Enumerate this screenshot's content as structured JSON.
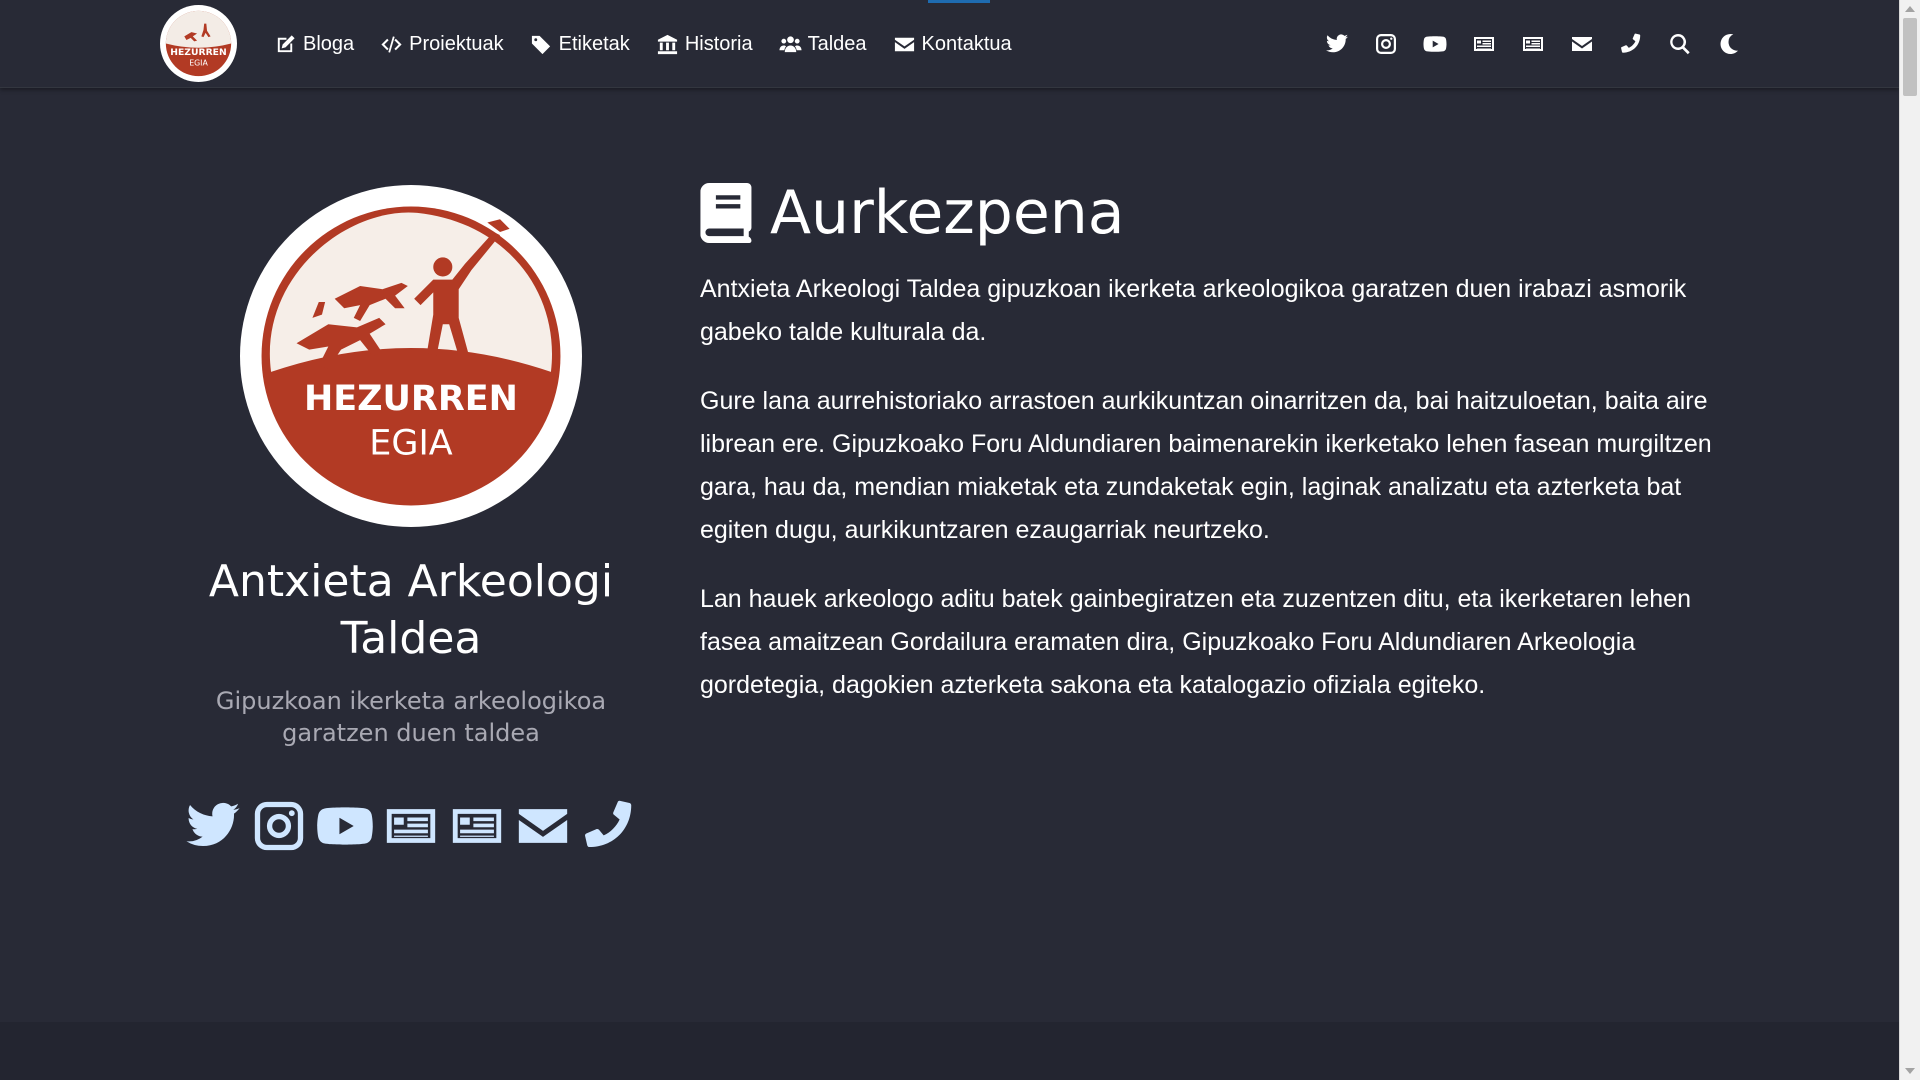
{
  "nav": {
    "links": [
      {
        "label": "Bloga",
        "icon": "edit-icon"
      },
      {
        "label": "Proiektuak",
        "icon": "code-icon"
      },
      {
        "label": "Etiketak",
        "icon": "tags-icon"
      },
      {
        "label": "Historia",
        "icon": "museum-icon"
      },
      {
        "label": "Taldea",
        "icon": "users-icon"
      },
      {
        "label": "Kontaktua",
        "icon": "envelope-icon"
      }
    ],
    "icons": [
      "twitter-icon",
      "instagram-icon",
      "youtube-icon",
      "newspaper-icon",
      "newspaper-icon",
      "envelope-icon",
      "phone-icon",
      "search-icon",
      "moon-icon"
    ]
  },
  "logo": {
    "line1": "HEZURREN",
    "line2": "EGIA"
  },
  "profile": {
    "name": "Antxieta Arkeologi Taldea",
    "tagline": "Gipuzkoan ikerketa arkeologikoa garatzen duen taldea",
    "social": [
      "twitter-icon",
      "instagram-icon",
      "youtube-icon",
      "newspaper-icon",
      "newspaper-icon",
      "envelope-icon",
      "phone-icon"
    ]
  },
  "content": {
    "title": "Aurkezpena",
    "paragraphs": [
      "Antxieta Arkeologi Taldea gipuzkoan ikerketa arkeologikoa garatzen duen irabazi asmorik gabeko talde kulturala da.",
      "Gure lana aurrehistoriako arrastoen aurkikuntzan oinarritzen da, bai haitzuloetan, baita aire librean ere. Gipuzkoako Foru Aldundiaren baimenarekin ikerketako lehen fasean murgiltzen gara, hau da, mendian miaketak eta zundaketak egin, laginak analizatu eta azterketa bat egiten dugu, aurkikuntzaren ezaugarriak neurtzeko.",
      "Lan hauek arkeologo aditu batek gainbegiratzen eta zuzentzen ditu, eta ikerketaren lehen fasea amaitzean Gordailura eramaten dira, Gipuzkoako Foru Aldundiaren Arkeologia gordetegia, dagokien azterketa sakona eta katalogazio ofiziala egiteko."
    ]
  },
  "colors": {
    "background": "#282a36",
    "logo_red": "#b23a24",
    "social_icon": "#cfe6ff",
    "tagline": "#a9a9b3"
  }
}
